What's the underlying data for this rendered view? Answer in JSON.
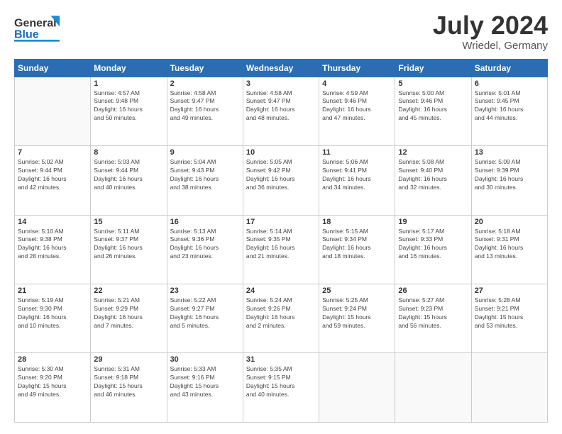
{
  "header": {
    "logo_general": "General",
    "logo_blue": "Blue",
    "month_year": "July 2024",
    "location": "Wriedel, Germany"
  },
  "calendar": {
    "days_of_week": [
      "Sunday",
      "Monday",
      "Tuesday",
      "Wednesday",
      "Thursday",
      "Friday",
      "Saturday"
    ],
    "weeks": [
      [
        {
          "day": "",
          "info": ""
        },
        {
          "day": "1",
          "info": "Sunrise: 4:57 AM\nSunset: 9:48 PM\nDaylight: 16 hours\nand 50 minutes."
        },
        {
          "day": "2",
          "info": "Sunrise: 4:58 AM\nSunset: 9:47 PM\nDaylight: 16 hours\nand 49 minutes."
        },
        {
          "day": "3",
          "info": "Sunrise: 4:58 AM\nSunset: 9:47 PM\nDaylight: 16 hours\nand 48 minutes."
        },
        {
          "day": "4",
          "info": "Sunrise: 4:59 AM\nSunset: 9:46 PM\nDaylight: 16 hours\nand 47 minutes."
        },
        {
          "day": "5",
          "info": "Sunrise: 5:00 AM\nSunset: 9:46 PM\nDaylight: 16 hours\nand 45 minutes."
        },
        {
          "day": "6",
          "info": "Sunrise: 5:01 AM\nSunset: 9:45 PM\nDaylight: 16 hours\nand 44 minutes."
        }
      ],
      [
        {
          "day": "7",
          "info": "Sunrise: 5:02 AM\nSunset: 9:44 PM\nDaylight: 16 hours\nand 42 minutes."
        },
        {
          "day": "8",
          "info": "Sunrise: 5:03 AM\nSunset: 9:44 PM\nDaylight: 16 hours\nand 40 minutes."
        },
        {
          "day": "9",
          "info": "Sunrise: 5:04 AM\nSunset: 9:43 PM\nDaylight: 16 hours\nand 38 minutes."
        },
        {
          "day": "10",
          "info": "Sunrise: 5:05 AM\nSunset: 9:42 PM\nDaylight: 16 hours\nand 36 minutes."
        },
        {
          "day": "11",
          "info": "Sunrise: 5:06 AM\nSunset: 9:41 PM\nDaylight: 16 hours\nand 34 minutes."
        },
        {
          "day": "12",
          "info": "Sunrise: 5:08 AM\nSunset: 9:40 PM\nDaylight: 16 hours\nand 32 minutes."
        },
        {
          "day": "13",
          "info": "Sunrise: 5:09 AM\nSunset: 9:39 PM\nDaylight: 16 hours\nand 30 minutes."
        }
      ],
      [
        {
          "day": "14",
          "info": "Sunrise: 5:10 AM\nSunset: 9:38 PM\nDaylight: 16 hours\nand 28 minutes."
        },
        {
          "day": "15",
          "info": "Sunrise: 5:11 AM\nSunset: 9:37 PM\nDaylight: 16 hours\nand 26 minutes."
        },
        {
          "day": "16",
          "info": "Sunrise: 5:13 AM\nSunset: 9:36 PM\nDaylight: 16 hours\nand 23 minutes."
        },
        {
          "day": "17",
          "info": "Sunrise: 5:14 AM\nSunset: 9:35 PM\nDaylight: 16 hours\nand 21 minutes."
        },
        {
          "day": "18",
          "info": "Sunrise: 5:15 AM\nSunset: 9:34 PM\nDaylight: 16 hours\nand 18 minutes."
        },
        {
          "day": "19",
          "info": "Sunrise: 5:17 AM\nSunset: 9:33 PM\nDaylight: 16 hours\nand 16 minutes."
        },
        {
          "day": "20",
          "info": "Sunrise: 5:18 AM\nSunset: 9:31 PM\nDaylight: 16 hours\nand 13 minutes."
        }
      ],
      [
        {
          "day": "21",
          "info": "Sunrise: 5:19 AM\nSunset: 9:30 PM\nDaylight: 16 hours\nand 10 minutes."
        },
        {
          "day": "22",
          "info": "Sunrise: 5:21 AM\nSunset: 9:29 PM\nDaylight: 16 hours\nand 7 minutes."
        },
        {
          "day": "23",
          "info": "Sunrise: 5:22 AM\nSunset: 9:27 PM\nDaylight: 16 hours\nand 5 minutes."
        },
        {
          "day": "24",
          "info": "Sunrise: 5:24 AM\nSunset: 9:26 PM\nDaylight: 16 hours\nand 2 minutes."
        },
        {
          "day": "25",
          "info": "Sunrise: 5:25 AM\nSunset: 9:24 PM\nDaylight: 15 hours\nand 59 minutes."
        },
        {
          "day": "26",
          "info": "Sunrise: 5:27 AM\nSunset: 9:23 PM\nDaylight: 15 hours\nand 56 minutes."
        },
        {
          "day": "27",
          "info": "Sunrise: 5:28 AM\nSunset: 9:21 PM\nDaylight: 15 hours\nand 53 minutes."
        }
      ],
      [
        {
          "day": "28",
          "info": "Sunrise: 5:30 AM\nSunset: 9:20 PM\nDaylight: 15 hours\nand 49 minutes."
        },
        {
          "day": "29",
          "info": "Sunrise: 5:31 AM\nSunset: 9:18 PM\nDaylight: 15 hours\nand 46 minutes."
        },
        {
          "day": "30",
          "info": "Sunrise: 5:33 AM\nSunset: 9:16 PM\nDaylight: 15 hours\nand 43 minutes."
        },
        {
          "day": "31",
          "info": "Sunrise: 5:35 AM\nSunset: 9:15 PM\nDaylight: 15 hours\nand 40 minutes."
        },
        {
          "day": "",
          "info": ""
        },
        {
          "day": "",
          "info": ""
        },
        {
          "day": "",
          "info": ""
        }
      ]
    ]
  }
}
